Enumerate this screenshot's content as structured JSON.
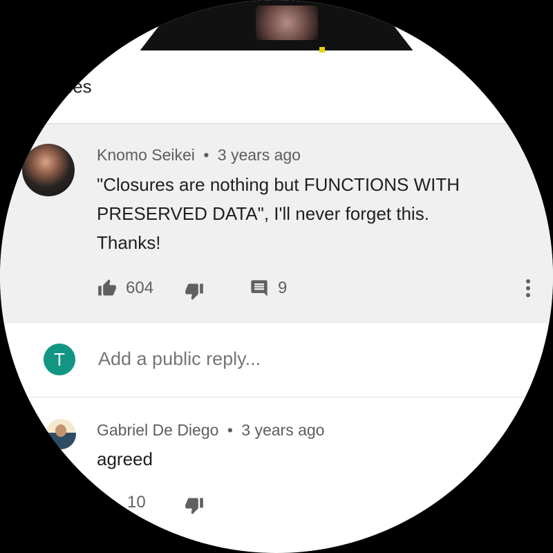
{
  "section": {
    "title": ".es"
  },
  "comments": [
    {
      "author": "Knomo Seikei",
      "time": "3 years ago",
      "text_lines": [
        "\"Closures are nothing but FUNCTIONS WITH",
        "PRESERVED DATA\", I'll never forget this.",
        "Thanks!"
      ],
      "likes": "604",
      "replies": "9"
    }
  ],
  "reply_box": {
    "avatar_letter": "T",
    "placeholder": "Add a public reply..."
  },
  "replies": [
    {
      "author": "Gabriel De Diego",
      "time": "3 years ago",
      "text": "agreed",
      "likes": "10"
    }
  ],
  "meta_separator": "•",
  "colors": {
    "reply_avatar": "#129683",
    "card_bg": "#f0f0f0",
    "icon_gray": "#606060"
  },
  "icons": [
    "thumb-up-icon",
    "thumb-down-icon",
    "comment-icon",
    "more-vert-icon"
  ]
}
